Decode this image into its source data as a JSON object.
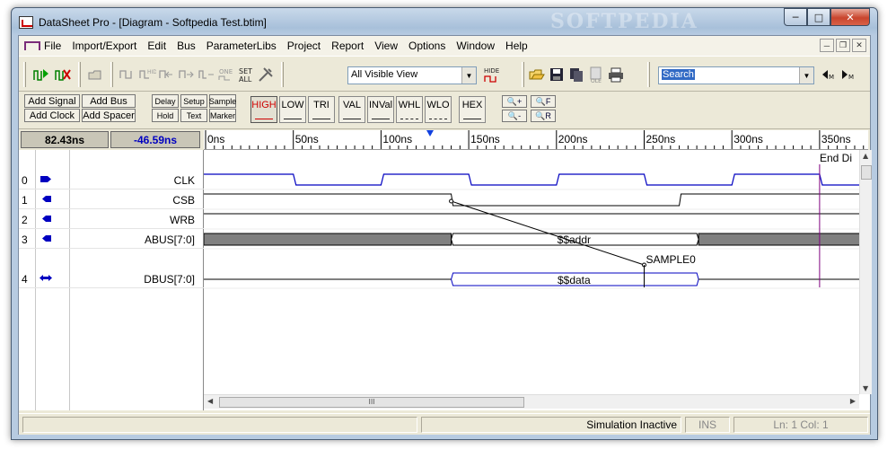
{
  "window": {
    "title": "DataSheet Pro - [Diagram - Softpedia Test.btim]",
    "watermark": "SOFTPEDIA"
  },
  "menu": [
    "File",
    "Import/Export",
    "Edit",
    "Bus",
    "ParameterLibs",
    "Project",
    "Report",
    "View",
    "Options",
    "Window",
    "Help"
  ],
  "toolbar": {
    "view_select": "All Visible View",
    "hide_label": "HIDE",
    "search_value": "Search",
    "icons": [
      "run-sim-icon",
      "stop-sim-icon",
      "open-folder-icon",
      "hide-icon",
      "one-icon",
      "set-all-icon",
      "tools-icon",
      "open-file-icon",
      "save-icon",
      "copy-icon",
      "ole-icon",
      "print-icon",
      "find-prev-icon",
      "find-next-icon"
    ],
    "one_label": "ONE",
    "set_label": "SET",
    "all_label": "ALL"
  },
  "toolbar2": {
    "add_signal": "Add Signal",
    "add_bus": "Add Bus",
    "add_clock": "Add Clock",
    "add_spacer": "Add Spacer",
    "delay": "Delay",
    "setup": "Setup",
    "sample": "Sample",
    "hold": "Hold",
    "text": "Text",
    "marker": "Marker",
    "high": "HIGH",
    "low": "LOW",
    "tri": "TRI",
    "val": "VAL",
    "inval": "INVal",
    "whl": "WHL",
    "wlo": "WLO",
    "hex": "HEX",
    "zoom_in": "+",
    "zoom_out": "-",
    "zoom_f": "F",
    "zoom_r": "R"
  },
  "time": {
    "cursor_time": "82.43ns",
    "delta_time": "-46.59ns",
    "ruler_labels": [
      "0ns",
      "50ns",
      "100ns",
      "150ns",
      "200ns",
      "250ns",
      "300ns",
      "350ns"
    ],
    "end_label": "End Di"
  },
  "signals": [
    {
      "index": "0",
      "name": "CLK",
      "type": "clock"
    },
    {
      "index": "1",
      "name": "CSB",
      "type": "output"
    },
    {
      "index": "2",
      "name": "WRB",
      "type": "output"
    },
    {
      "index": "3",
      "name": "ABUS[7:0]",
      "type": "output",
      "bus_value": "$$addr"
    },
    {
      "index": "4",
      "name": "DBUS[7:0]",
      "type": "bidir",
      "bus_value": "$$data"
    }
  ],
  "annotations": {
    "sample_label": "SAMPLE0"
  },
  "scroll": {
    "grip": "III"
  },
  "status": {
    "message": "Simulation Inactive",
    "mode": "INS",
    "position": "Ln: 1  Col: 1"
  },
  "colors": {
    "clock_wave": "#0000c0",
    "bus_fill": "#808080",
    "marker_line": "#800080",
    "high_red": "#cc0000"
  }
}
